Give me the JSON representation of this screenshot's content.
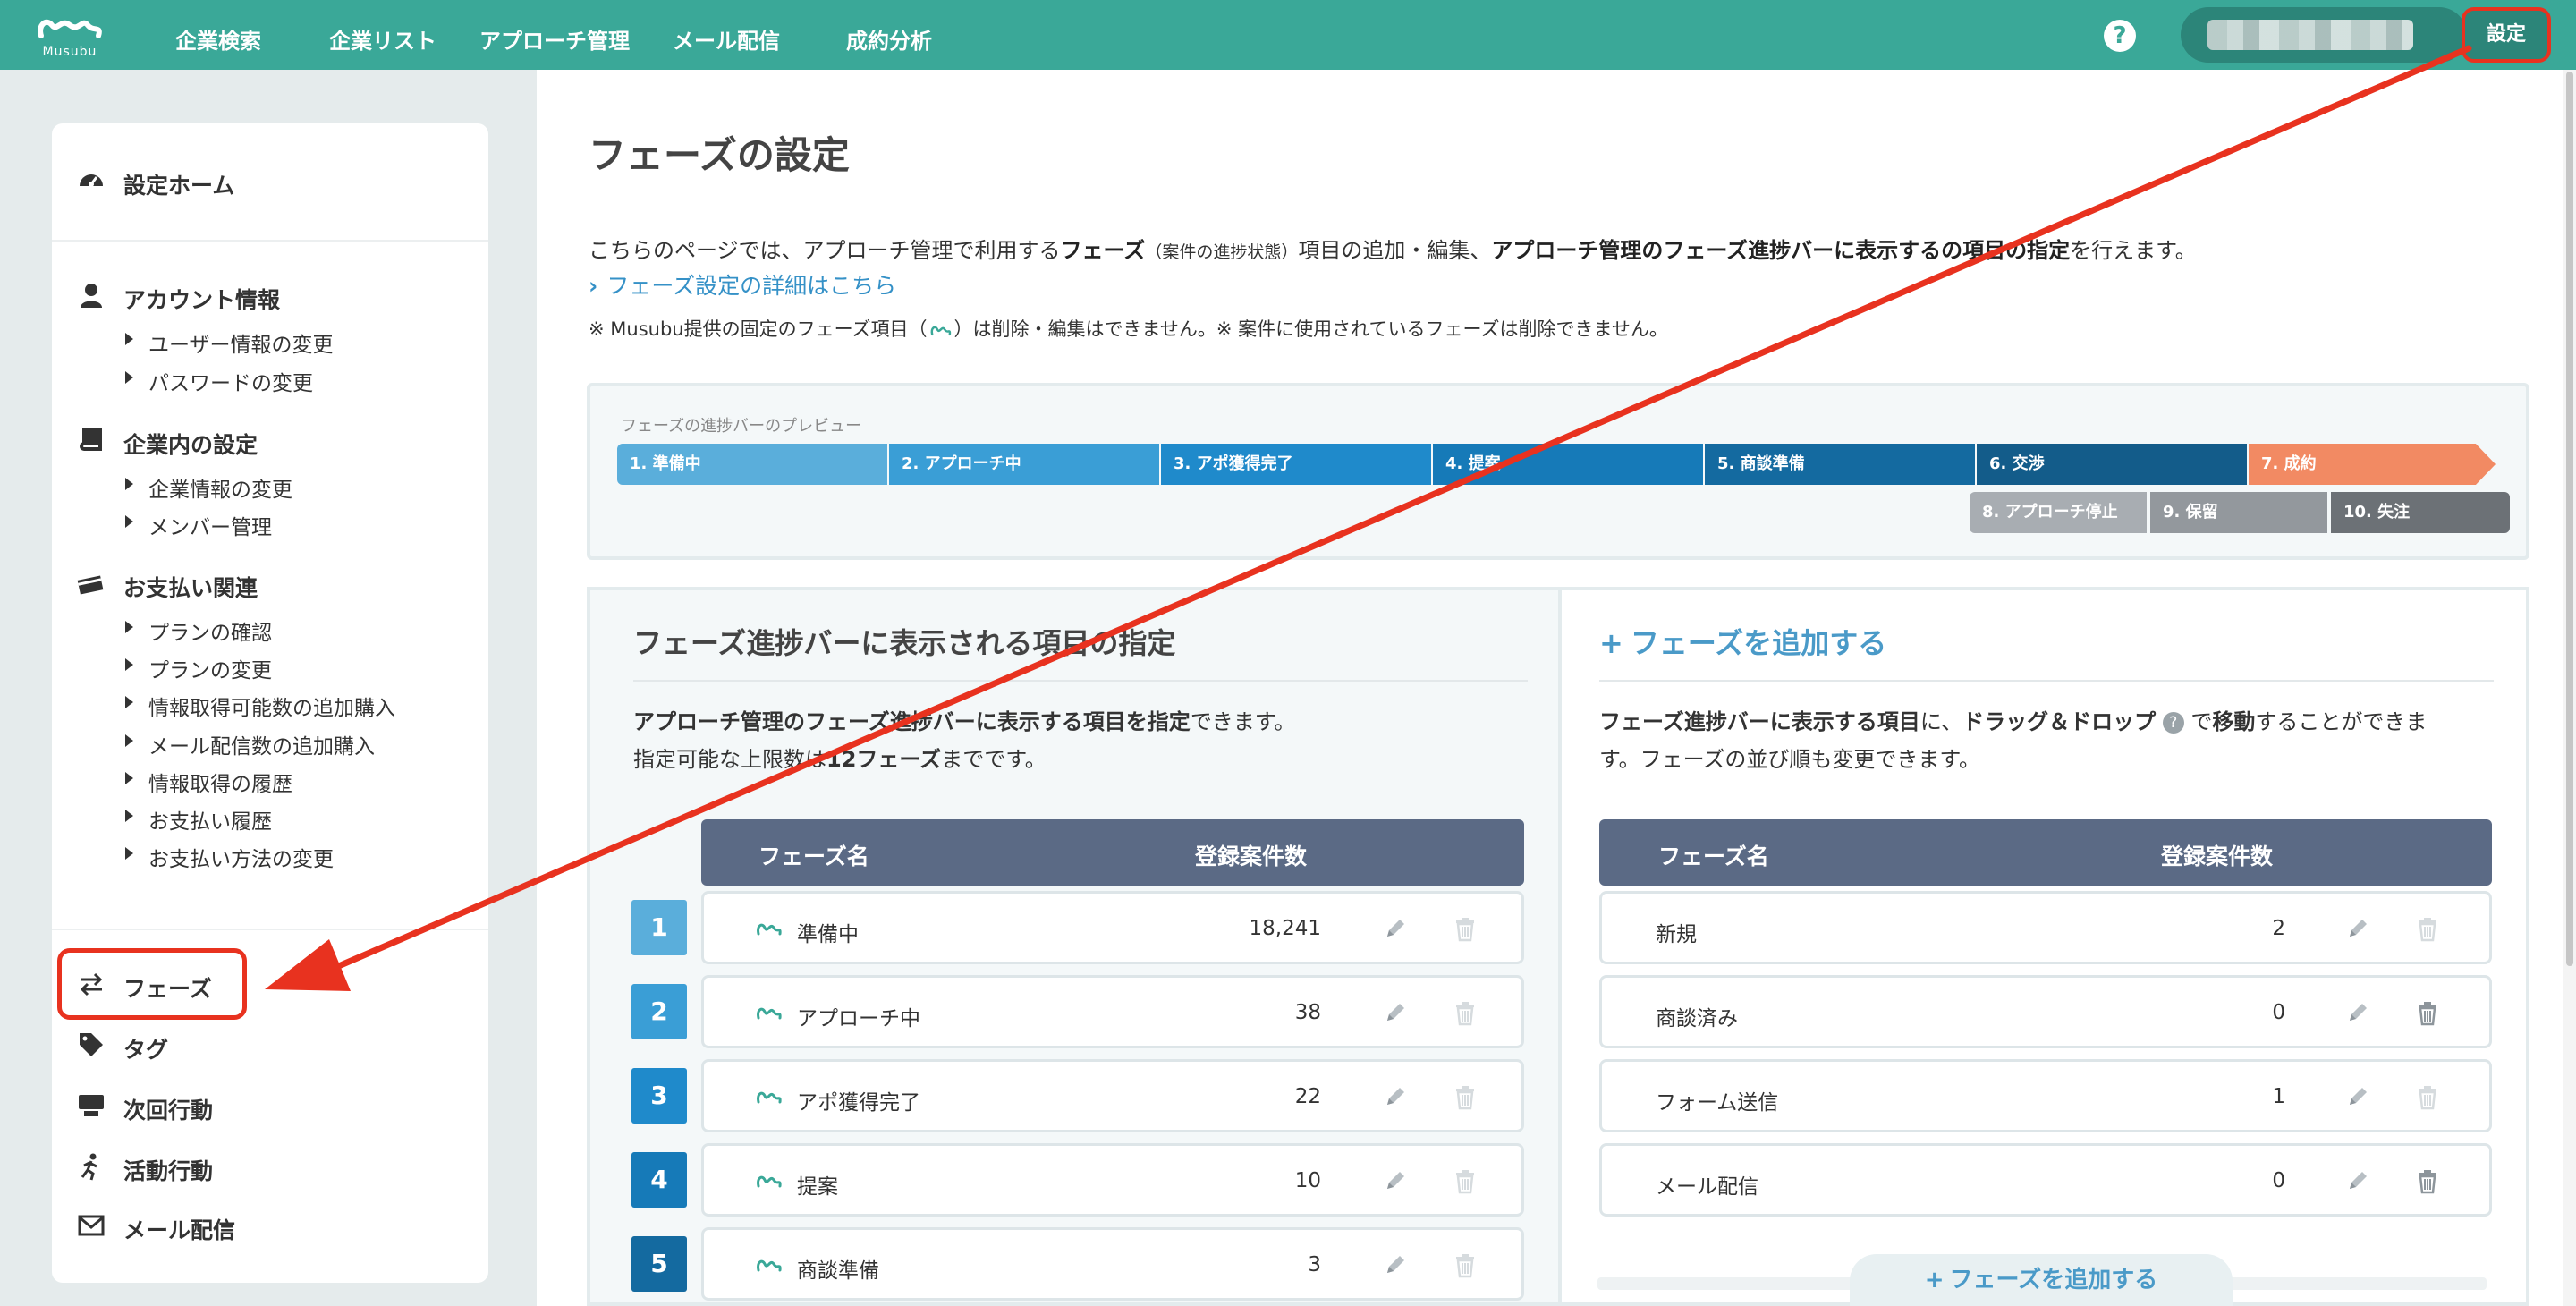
{
  "nav": {
    "logo_text": "Musubu",
    "items": [
      "企業検索",
      "企業リスト",
      "アプローチ管理",
      "メール配信",
      "成約分析"
    ],
    "help_label": "?",
    "settings_label": "設定"
  },
  "sidebar": {
    "home": "設定ホーム",
    "account": {
      "title": "アカウント情報",
      "items": [
        "ユーザー情報の変更",
        "パスワードの変更"
      ]
    },
    "company": {
      "title": "企業内の設定",
      "items": [
        "企業情報の変更",
        "メンバー管理"
      ]
    },
    "payment": {
      "title": "お支払い関連",
      "items": [
        "プランの確認",
        "プランの変更",
        "情報取得可能数の追加購入",
        "メール配信数の追加購入",
        "情報取得の履歴",
        "お支払い履歴",
        "お支払い方法の変更"
      ]
    },
    "bottom": [
      "フェーズ",
      "タグ",
      "次回行動",
      "活動行動",
      "メール配信"
    ]
  },
  "page": {
    "title": "フェーズの設定",
    "desc_1": "こちらのページでは、アプローチ管理で利用する",
    "desc_2": "フェーズ",
    "desc_3": "（案件の進捗状態）",
    "desc_4": "項目の追加・編集、",
    "desc_5": "アプローチ管理のフェーズ進捗バーに表示するの項目の指定",
    "desc_6": "を行えます。",
    "detail_link": "フェーズ設定の詳細はこちら",
    "note_1": "※ Musubu提供の固定のフェーズ項目（",
    "note_2": "）は削除・編集はできません。※ 案件に使用されているフェーズは削除できません。"
  },
  "preview": {
    "label": "フェーズの進捗バーのプレビュー",
    "main_bars": [
      {
        "label": "1. 準備中",
        "color": "#5aaedb"
      },
      {
        "label": "2. アプローチ中",
        "color": "#3a9ed6"
      },
      {
        "label": "3. アポ獲得完了",
        "color": "#1f8acb"
      },
      {
        "label": "4. 提案",
        "color": "#167ab8"
      },
      {
        "label": "5. 商談準備",
        "color": "#146aa0"
      },
      {
        "label": "6. 交渉",
        "color": "#135c8a"
      },
      {
        "label": "7. 成約",
        "color": "#f28a63"
      }
    ],
    "stop_bars": [
      {
        "label": "8. アプローチ停止",
        "color": "#a8adb2"
      },
      {
        "label": "9. 保留",
        "color": "#93989d"
      },
      {
        "label": "10. 失注",
        "color": "#6c7176"
      }
    ]
  },
  "left_panel": {
    "title": "フェーズ進捗バーに表示される項目の指定",
    "text_1a": "アプローチ管理のフェーズ進捗バーに表示する項目を指定",
    "text_1b": "できます。",
    "text_2a": "指定可能な上限数は",
    "text_2b": "12フェーズ",
    "text_2c": "までです。",
    "col_name": "フェーズ名",
    "col_count": "登録案件数",
    "rows": [
      {
        "num": "1",
        "name": "準備中",
        "count": "18,241",
        "color": "#5aaedb"
      },
      {
        "num": "2",
        "name": "アプローチ中",
        "count": "38",
        "color": "#3a9ed6"
      },
      {
        "num": "3",
        "name": "アポ獲得完了",
        "count": "22",
        "color": "#1f8acb"
      },
      {
        "num": "4",
        "name": "提案",
        "count": "10",
        "color": "#167ab8"
      },
      {
        "num": "5",
        "name": "商談準備",
        "count": "3",
        "color": "#146aa0"
      }
    ]
  },
  "right_panel": {
    "title": "フェーズを追加する",
    "text_1a": "フェーズ進捗バーに表示する項目",
    "text_1b": "に、",
    "text_1c": "ドラッグ＆ドロップ",
    "text_1d": "で",
    "text_1e": "移動",
    "text_1f": "することができま",
    "text_2": "す。フェーズの並び順も変更できます。",
    "col_name": "フェーズ名",
    "col_count": "登録案件数",
    "rows": [
      {
        "name": "新規",
        "count": "2",
        "deletable": false
      },
      {
        "name": "商談済み",
        "count": "0",
        "deletable": true
      },
      {
        "name": "フォーム送信",
        "count": "1",
        "deletable": false
      },
      {
        "name": "メール配信",
        "count": "0",
        "deletable": true
      }
    ],
    "add_button": "フェーズを追加する"
  },
  "colors": {
    "brand": "#3aa898",
    "highlight": "#e8321f",
    "table_header": "#5b6a85",
    "link": "#3591c7"
  }
}
